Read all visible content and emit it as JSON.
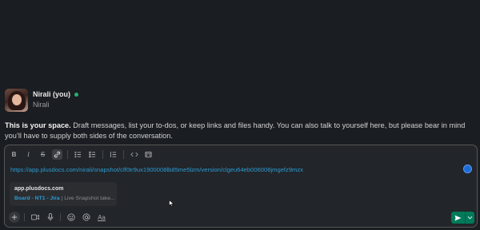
{
  "profile": {
    "name": "Nirali (you)",
    "subtitle": "Nirali",
    "status_color": "#2bac76"
  },
  "intro": {
    "bold": "This is your space.",
    "text": " Draft messages, list your to-dos, or keep links and files handy. You can also talk to yourself here, but please bear in mind you’ll have to supply both sides of the conversation."
  },
  "toolbar": {
    "items": [
      {
        "name": "bold-icon",
        "glyph": "B"
      },
      {
        "name": "italic-icon",
        "glyph": "I"
      },
      {
        "name": "strikethrough-icon",
        "glyph": "S"
      },
      {
        "name": "link-icon",
        "glyph": "🔗",
        "active": true
      },
      {
        "name": "ordered-list-icon",
        "glyph": "≔"
      },
      {
        "name": "bulleted-list-icon",
        "glyph": "☰"
      },
      {
        "name": "blockquote-icon",
        "glyph": "▏≡"
      },
      {
        "name": "code-icon",
        "glyph": "</>"
      },
      {
        "name": "code-block-icon",
        "glyph": "▭"
      }
    ]
  },
  "message": {
    "url": "https://app.plusdocs.com/nirali/snapshot/clf0tr9ux1900008lb85me5lzm/version/clgeu64eb006008jmgefz9mzx"
  },
  "unfurl": {
    "domain": "app.plusdocs.com",
    "link": "Board - NT1 - Jira",
    "separator": " | ",
    "description": "Live Snapshot take..."
  },
  "bottombar": {
    "format_label": "Aa"
  },
  "colors": {
    "accent": "#2b9bd4",
    "send": "#007a5a",
    "background": "#1a1d21"
  }
}
